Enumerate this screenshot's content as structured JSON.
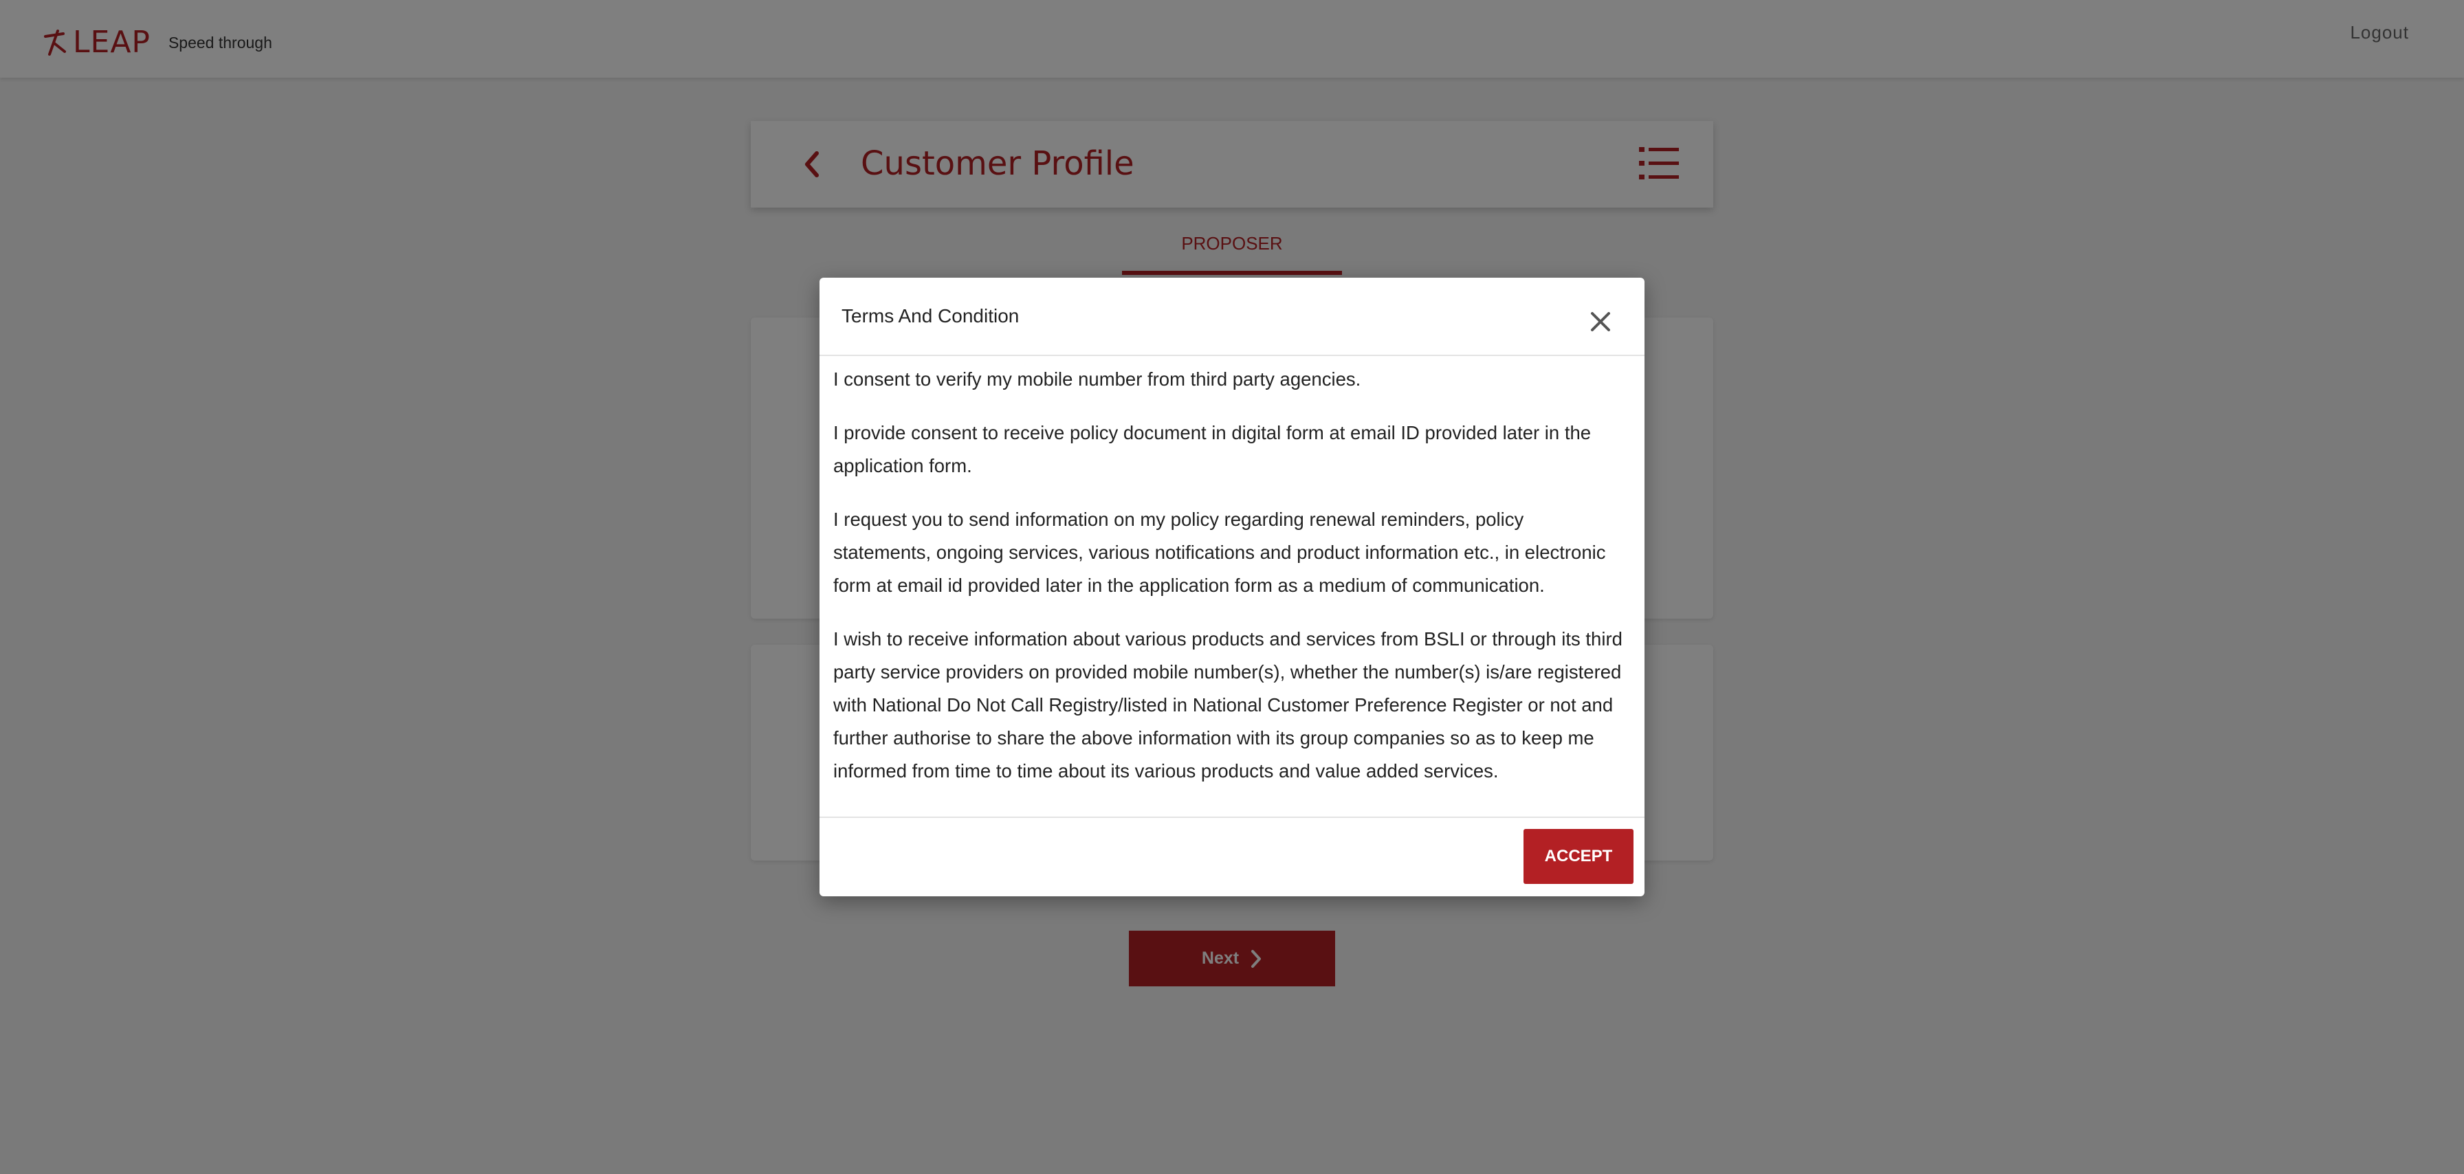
{
  "app": {
    "logo_text": "LEAP",
    "tagline": "Speed through",
    "logout_label": "Logout"
  },
  "header": {
    "title": "Customer Profile"
  },
  "tabs": [
    {
      "label": "PROPOSER",
      "active": true
    }
  ],
  "next_label": "Next",
  "modal": {
    "title": "Terms And Condition",
    "paragraphs": [
      "I consent to verify my mobile number from third party agencies.",
      "I provide consent to receive policy document in digital form at email ID provided later in the application form.",
      "I request you to send information on my policy regarding renewal reminders, policy statements, ongoing services, various notifications and product information etc., in electronic form at email id provided later in the application form as a medium of communication.",
      "I wish to receive information about various products and services from BSLI or through its third party service providers on provided mobile number(s), whether the number(s) is/are registered with National Do Not Call Registry/listed in National Customer Preference Register or not and further authorise to share the above information with its group companies so as to keep me informed from time to time about its various products and value added services."
    ],
    "accept_label": "ACCEPT"
  },
  "colors": {
    "brand": "#b32024",
    "overlay": "rgba(0,0,0,0.5)"
  },
  "icons": [
    "leap-logo-icon",
    "back-chevron-icon",
    "menu-list-icon",
    "close-icon",
    "chevron-right-icon"
  ]
}
